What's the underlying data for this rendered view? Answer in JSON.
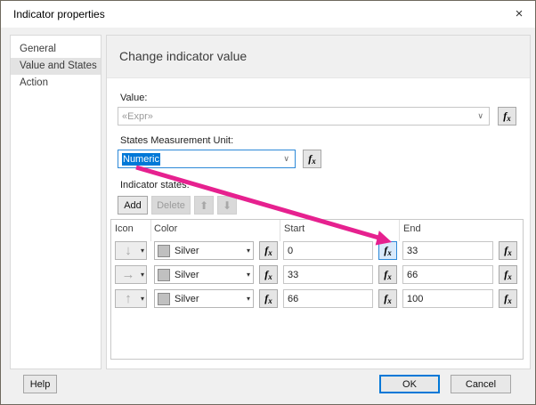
{
  "window": {
    "title": "Indicator properties",
    "close_glyph": "×"
  },
  "sidebar": {
    "items": [
      {
        "label": "General"
      },
      {
        "label": "Value and States"
      },
      {
        "label": "Action"
      }
    ],
    "selected_index": 1
  },
  "main": {
    "heading": "Change indicator value",
    "value": {
      "label": "Value:",
      "text": "«Expr»"
    },
    "unit": {
      "label": "States Measurement Unit:",
      "text": "Numeric"
    },
    "states": {
      "label": "Indicator states:",
      "add_label": "Add",
      "delete_label": "Delete",
      "move_up_glyph": "⬆",
      "move_down_glyph": "⬇",
      "table": {
        "headers": [
          "Icon",
          "Color",
          "Start",
          "End"
        ],
        "rows": [
          {
            "icon": "down-arrow",
            "icon_glyph": "↓",
            "color": "Silver",
            "start": "0",
            "end": "33",
            "start_fx_highlighted": true
          },
          {
            "icon": "right-arrow",
            "icon_glyph": "→",
            "color": "Silver",
            "start": "33",
            "end": "66",
            "start_fx_highlighted": false
          },
          {
            "icon": "up-arrow",
            "icon_glyph": "↑",
            "color": "Silver",
            "start": "66",
            "end": "100",
            "start_fx_highlighted": false
          }
        ]
      }
    },
    "fx": {
      "f": "f",
      "x": "x"
    }
  },
  "footer": {
    "help": "Help",
    "ok": "OK",
    "cancel": "Cancel"
  },
  "icons": {
    "chevron": "∨",
    "dropdown": "▾"
  },
  "colors": {
    "accent": "#0078d7",
    "selection_bg": "#0078d7",
    "annotation_arrow": "#e6218f",
    "silver_swatch": "#c0c0c0",
    "fx_highlight_border": "#2d89d8",
    "fx_highlight_bg": "#d9eafb"
  }
}
